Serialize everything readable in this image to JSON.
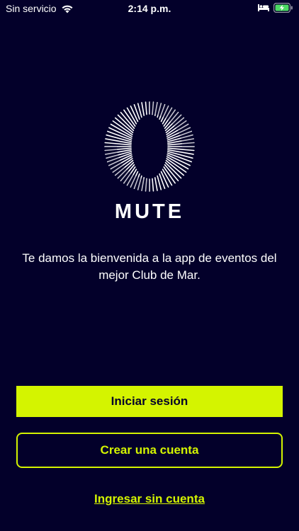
{
  "status_bar": {
    "carrier": "Sin servicio",
    "time": "2:14 p.m.",
    "wifi_icon": "wifi-icon",
    "sleep_icon": "bed-icon",
    "battery_icon": "battery-charging-icon"
  },
  "logo": {
    "icon": "mute-ring-logo",
    "wordmark": "MUTE"
  },
  "welcome": {
    "text": "Te damos la bienvenida a la app de eventos del mejor Club de Mar."
  },
  "actions": {
    "login_label": "Iniciar sesión",
    "create_account_label": "Crear una cuenta",
    "guest_label": "Ingresar sin cuenta"
  },
  "colors": {
    "background": "#03002a",
    "accent": "#d4f400",
    "text": "#ffffff",
    "battery": "#4cd964"
  }
}
